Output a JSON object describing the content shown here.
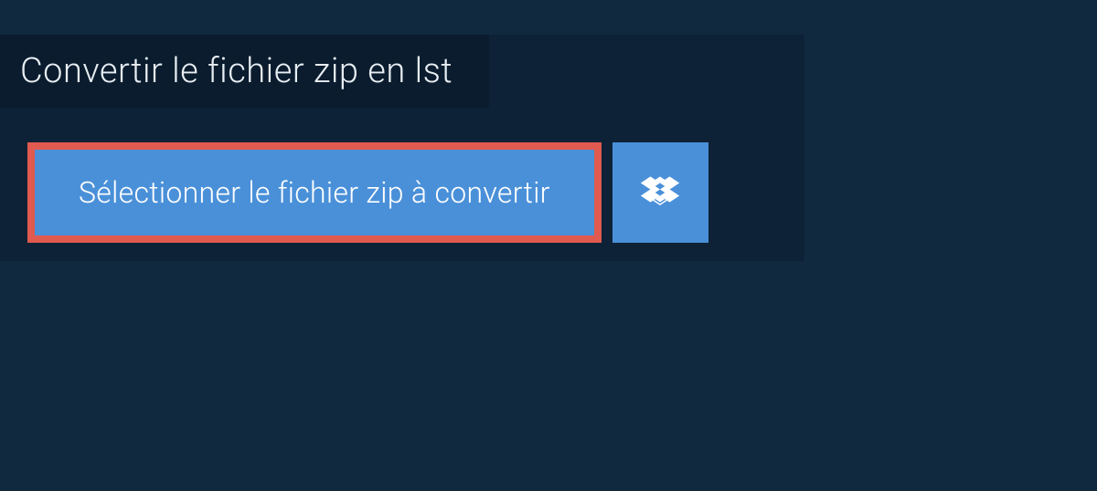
{
  "heading": "Convertir le fichier zip en lst",
  "select_button_label": "Sélectionner le fichier zip à convertir"
}
